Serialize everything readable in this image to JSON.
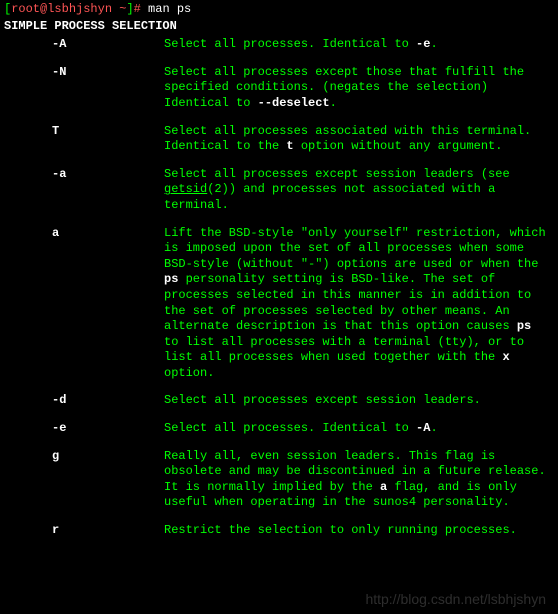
{
  "prompt": {
    "open_bracket": "[",
    "user": "root",
    "at": "@",
    "host": "lsbhjshyn",
    "path": " ~",
    "close_bracket": "]",
    "hash": "# ",
    "command": "man ps"
  },
  "section_header": "SIMPLE PROCESS SELECTION",
  "options": [
    {
      "flag": "-A",
      "desc": "Select all processes. Identical to <b>-e</b>."
    },
    {
      "flag": "-N",
      "desc": "Select all processes except those that fulfill the specified conditions. (negates the selection) Identical to <b>--deselect</b>."
    },
    {
      "flag": "T",
      "desc": "Select all processes associated with this terminal. Identical to the <b>t</b> option without any argument."
    },
    {
      "flag": "-a",
      "desc": "Select all processes except session leaders (see <u>getsid</u>(2)) and processes not associated with a terminal."
    },
    {
      "flag": "a",
      "desc": "Lift the BSD-style \"only yourself\" restriction, which is imposed upon the set of all processes when some BSD-style (without \"-\") options are used or when the <b>ps</b> personality setting is BSD-like. The set of processes selected in this manner is in addition to the set of processes selected by other means. An alternate description is that this option causes <b>ps</b> to list all processes with a terminal (tty), or to list all processes when used together with the <b>x</b> option."
    },
    {
      "flag": "-d",
      "desc": "Select all processes except session leaders."
    },
    {
      "flag": "-e",
      "desc": "Select all processes. Identical to <b>-A</b>."
    },
    {
      "flag": "g",
      "desc": "Really all, even session leaders. This flag is obsolete and may be discontinued in a future release. It is normally implied by the <b>a</b> flag, and is only useful when operating in the sunos4 personality."
    },
    {
      "flag": "r",
      "desc": "Restrict the selection to only running processes."
    }
  ],
  "watermark": "http://blog.csdn.net/lsbhjshyn"
}
